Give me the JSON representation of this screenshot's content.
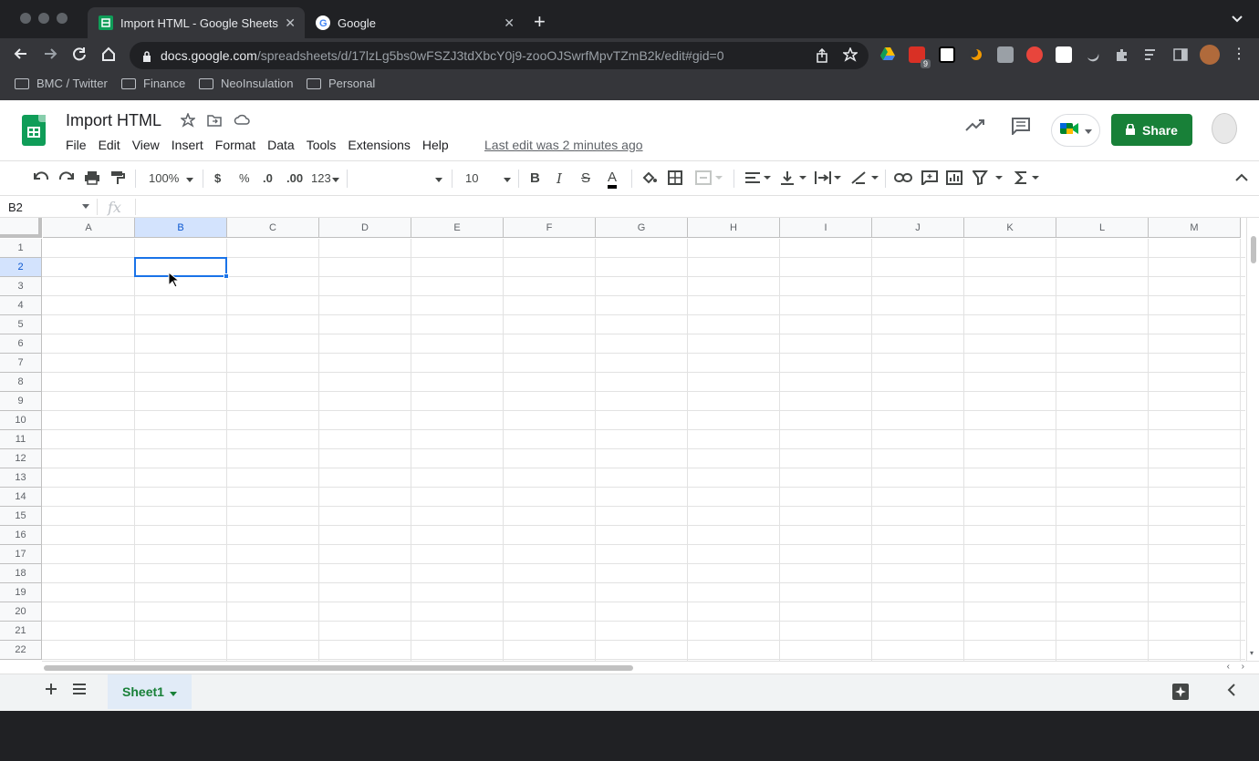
{
  "browser": {
    "tabs": [
      {
        "title": "Import HTML - Google Sheets",
        "active": true
      },
      {
        "title": "Google",
        "active": false
      }
    ],
    "url_host": "docs.google.com",
    "url_path": "/spreadsheets/d/17lzLg5bs0wFSZJ3tdXbcY0j9-zooOJSwrfMpvTZmB2k/edit#gid=0",
    "bookmarks": [
      "BMC / Twitter",
      "Finance",
      "NeoInsulation",
      "Personal"
    ],
    "ext_badge": "9"
  },
  "doc": {
    "title": "Import HTML",
    "menus": [
      "File",
      "Edit",
      "View",
      "Insert",
      "Format",
      "Data",
      "Tools",
      "Extensions",
      "Help"
    ],
    "last_edit": "Last edit was 2 minutes ago",
    "share_label": "Share"
  },
  "toolbar": {
    "zoom": "100%",
    "currency": "$",
    "percent": "%",
    "dec_decrease": ".0",
    "dec_increase": ".00",
    "more_formats": "123",
    "font_size": "10",
    "bold": "B",
    "italic": "I",
    "strike": "S",
    "text_color": "A"
  },
  "formula_bar": {
    "name_box": "B2",
    "fx": "fx",
    "value": ""
  },
  "grid": {
    "columns": [
      "A",
      "B",
      "C",
      "D",
      "E",
      "F",
      "G",
      "H",
      "I",
      "J",
      "K",
      "L",
      "M"
    ],
    "rows": [
      "1",
      "2",
      "3",
      "4",
      "5",
      "6",
      "7",
      "8",
      "9",
      "10",
      "11",
      "12",
      "13",
      "14",
      "15",
      "16",
      "17",
      "18",
      "19",
      "20",
      "21",
      "22"
    ],
    "selected_cell": "B2"
  },
  "sheets": {
    "active": "Sheet1"
  },
  "colors": {
    "accent": "#1a73e8",
    "share_green": "#188038",
    "sheets_green": "#0f9d58"
  }
}
